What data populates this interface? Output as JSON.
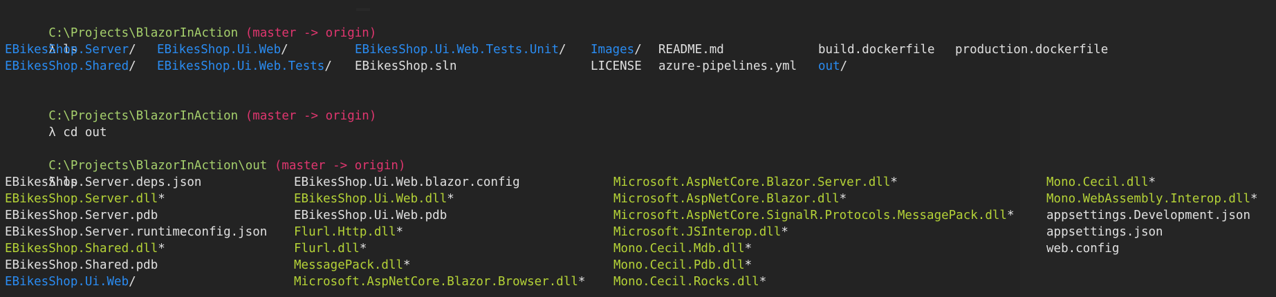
{
  "colors": {
    "background": "#232323",
    "prompt_path": "#a6d06c",
    "branch": "#e0366f",
    "directory": "#2a8cf2",
    "executable": "#b5d337",
    "text": "#e0e0e0"
  },
  "prompt1": {
    "path": "C:\\Projects\\BlazorInAction",
    "branch": "(master -> origin)",
    "command": "λ ls"
  },
  "ls1": {
    "row1": {
      "c1": "EBikesShop.Server",
      "c2": "EBikesShop.Ui.Web",
      "c3": "EBikesShop.Ui.Web.Tests.Unit",
      "c4": "Images",
      "c5": "README.md",
      "c6": "build.dockerfile",
      "c7": "production.dockerfile"
    },
    "row2": {
      "c1": "EBikesShop.Shared",
      "c2": "EBikesShop.Ui.Web.Tests",
      "c3": "EBikesShop.sln",
      "c4": "LICENSE",
      "c5": "azure-pipelines.yml",
      "c6": "out"
    }
  },
  "prompt2": {
    "path": "C:\\Projects\\BlazorInAction",
    "branch": "(master -> origin)",
    "command": "λ cd out"
  },
  "prompt3": {
    "path": "C:\\Projects\\BlazorInAction\\out",
    "branch": "(master -> origin)",
    "command": "λ ls"
  },
  "ls2": {
    "col1": [
      "EBikesShop.Server.deps.json",
      "EBikesShop.Server.dll",
      "EBikesShop.Server.pdb",
      "EBikesShop.Server.runtimeconfig.json",
      "EBikesShop.Shared.dll",
      "EBikesShop.Shared.pdb",
      "EBikesShop.Ui.Web"
    ],
    "col2": [
      "EBikesShop.Ui.Web.blazor.config",
      "EBikesShop.Ui.Web.dll",
      "EBikesShop.Ui.Web.pdb",
      "Flurl.Http.dll",
      "Flurl.dll",
      "MessagePack.dll",
      "Microsoft.AspNetCore.Blazor.Browser.dll"
    ],
    "col3": [
      "Microsoft.AspNetCore.Blazor.Server.dll",
      "Microsoft.AspNetCore.Blazor.dll",
      "Microsoft.AspNetCore.SignalR.Protocols.MessagePack.dll",
      "Microsoft.JSInterop.dll",
      "Mono.Cecil.Mdb.dll",
      "Mono.Cecil.Pdb.dll",
      "Mono.Cecil.Rocks.dll"
    ],
    "col4": [
      "Mono.Cecil.dll",
      "Mono.WebAssembly.Interop.dll",
      "appsettings.Development.json",
      "appsettings.json",
      "web.config"
    ]
  },
  "suffix": {
    "slash": "/",
    "star": "*"
  }
}
